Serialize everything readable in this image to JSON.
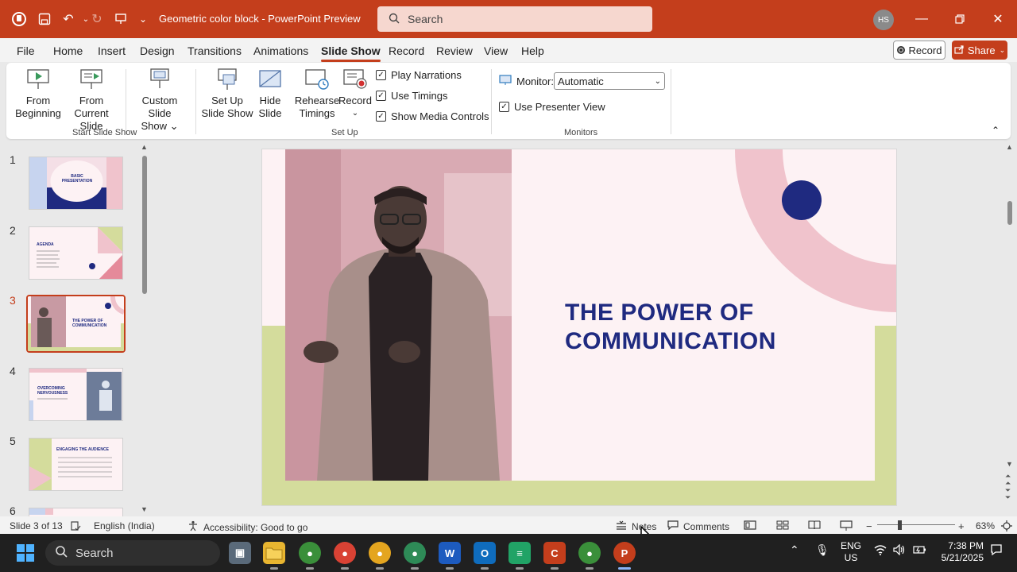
{
  "window": {
    "doc_title": "Geometric color block  -  PowerPoint Preview",
    "search_placeholder": "Search",
    "avatar_initials": "HS"
  },
  "menu": {
    "tabs": [
      "File",
      "Home",
      "Insert",
      "Design",
      "Transitions",
      "Animations",
      "Slide Show",
      "Record",
      "Review",
      "View",
      "Help"
    ],
    "active_tab": "Slide Show",
    "record_label": "Record",
    "share_label": "Share"
  },
  "ribbon": {
    "from_beginning": [
      "From",
      "Beginning"
    ],
    "from_current": [
      "From",
      "Current Slide"
    ],
    "custom_show": [
      "Custom Slide",
      "Show ⌄"
    ],
    "start_group": "Start Slide Show",
    "setup_show": [
      "Set Up",
      "Slide Show"
    ],
    "hide_slide": [
      "Hide",
      "Slide"
    ],
    "rehearse": [
      "Rehearse",
      "Timings"
    ],
    "record": [
      "Record",
      "⌄"
    ],
    "checks": [
      {
        "label": "Play Narrations",
        "checked": true
      },
      {
        "label": "Use Timings",
        "checked": true
      },
      {
        "label": "Show Media Controls",
        "checked": true
      }
    ],
    "setup_group": "Set Up",
    "monitor_label": "Monitor:",
    "monitor_value": "Automatic",
    "presenter_view": "Use Presenter View",
    "monitors_group": "Monitors"
  },
  "thumbnails": {
    "numbers": [
      "1",
      "2",
      "3",
      "4",
      "5",
      "6"
    ],
    "active_index": 3,
    "t1_title": "BASIC PRESENTATION",
    "t2_title": "AGENDA",
    "t3_title": "THE POWER OF COMMUNICATION",
    "t4_title": "OVERCOMING NERVOUSNESS",
    "t5_title": "ENGAGING THE AUDIENCE"
  },
  "slide": {
    "title_line1": "THE POWER OF",
    "title_line2": "COMMUNICATION",
    "colors": {
      "navy": "#1f2a80",
      "pink": "#f0c3cc",
      "green": "#d4dc9c",
      "bg": "#fdf2f4"
    }
  },
  "status": {
    "slide_of": "Slide 3 of 13",
    "language": "English (India)",
    "accessibility": "Accessibility: Good to go",
    "notes": "Notes",
    "comments": "Comments",
    "zoom": "63%"
  },
  "taskbar": {
    "search": "Search",
    "lang1": "ENG",
    "lang2": "US",
    "time": "7:38 PM",
    "date": "5/21/2025"
  }
}
